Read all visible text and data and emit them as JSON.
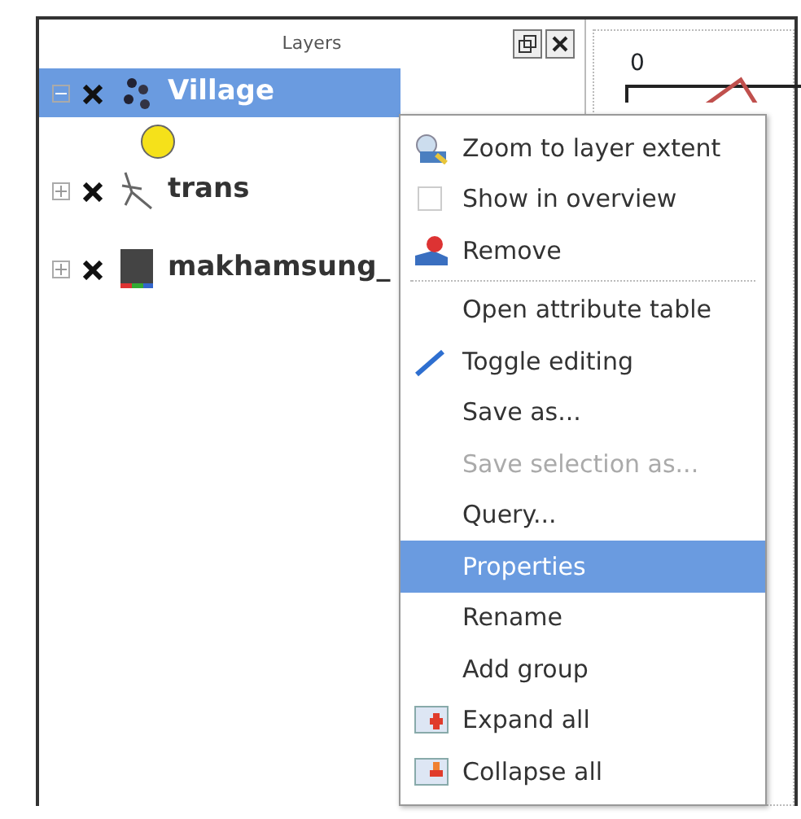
{
  "panel": {
    "title": "Layers"
  },
  "layers": [
    {
      "name": "Village",
      "kind": "points",
      "selected": true,
      "visible": true,
      "expanded": true
    },
    {
      "name": "trans",
      "kind": "lines",
      "selected": false,
      "visible": true,
      "expanded": false
    },
    {
      "name": "makhamsung_",
      "kind": "raster",
      "selected": false,
      "visible": true,
      "expanded": false
    }
  ],
  "map": {
    "scale_label": "0"
  },
  "menu": [
    {
      "label": "Zoom to layer extent",
      "kind": "zoom",
      "disabled": false,
      "selected": false,
      "separator_after": false
    },
    {
      "label": "Show in overview",
      "kind": "check",
      "checked": false,
      "disabled": false,
      "selected": false,
      "separator_after": false
    },
    {
      "label": "Remove",
      "kind": "remove",
      "disabled": false,
      "selected": false,
      "separator_after": true
    },
    {
      "label": "Open attribute table",
      "kind": "plain",
      "disabled": false,
      "selected": false,
      "separator_after": false
    },
    {
      "label": "Toggle editing",
      "kind": "edit",
      "disabled": false,
      "selected": false,
      "separator_after": false
    },
    {
      "label": "Save as...",
      "kind": "plain",
      "disabled": false,
      "selected": false,
      "separator_after": false
    },
    {
      "label": "Save selection as...",
      "kind": "plain",
      "disabled": true,
      "selected": false,
      "separator_after": false
    },
    {
      "label": "Query...",
      "kind": "plain",
      "disabled": false,
      "selected": false,
      "separator_after": false
    },
    {
      "label": "Properties",
      "kind": "plain",
      "disabled": false,
      "selected": true,
      "separator_after": false
    },
    {
      "label": "Rename",
      "kind": "plain",
      "disabled": false,
      "selected": false,
      "separator_after": false
    },
    {
      "label": "Add group",
      "kind": "plain",
      "disabled": false,
      "selected": false,
      "separator_after": false
    },
    {
      "label": "Expand all",
      "kind": "expand",
      "disabled": false,
      "selected": false,
      "separator_after": false
    },
    {
      "label": "Collapse all",
      "kind": "collapse",
      "disabled": false,
      "selected": false,
      "separator_after": false
    }
  ]
}
